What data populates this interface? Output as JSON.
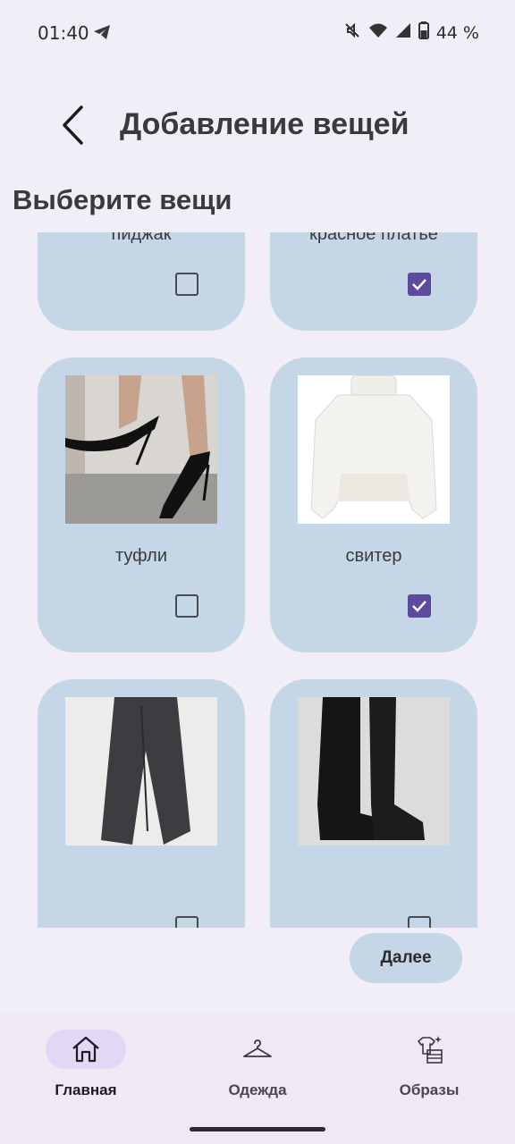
{
  "status_bar": {
    "time": "01:40",
    "battery": "44 %"
  },
  "header": {
    "title": "Добавление вещей"
  },
  "section": {
    "title": "Выберите вещи"
  },
  "items": [
    {
      "label": "пиджак",
      "checked": false,
      "image": "black-blazer"
    },
    {
      "label": "красное платье",
      "checked": true,
      "image": "red-dress"
    },
    {
      "label": "туфли",
      "checked": false,
      "image": "black-heels"
    },
    {
      "label": "свитер",
      "checked": true,
      "image": "white-sweater"
    },
    {
      "label": "",
      "checked": false,
      "image": "grey-trousers"
    },
    {
      "label": "",
      "checked": false,
      "image": "black-boots"
    }
  ],
  "actions": {
    "next_label": "Далее"
  },
  "bottom_nav": [
    {
      "label": "Главная",
      "icon": "home-icon",
      "active": true
    },
    {
      "label": "Одежда",
      "icon": "hanger-icon",
      "active": false
    },
    {
      "label": "Образы",
      "icon": "outfits-icon",
      "active": false
    }
  ],
  "colors": {
    "card": "#c5d7e6",
    "checkbox_checked": "#5b4a9e",
    "background": "#f1eef8",
    "nav_active": "#e2d8f5"
  }
}
